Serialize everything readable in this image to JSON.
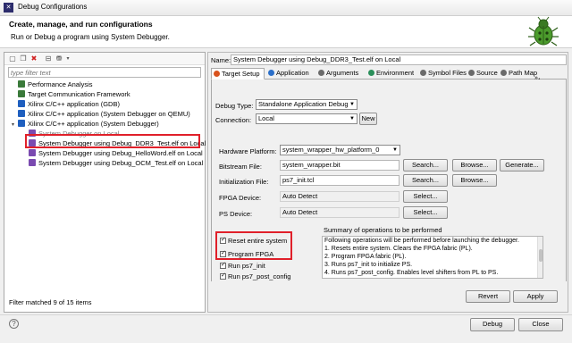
{
  "window": {
    "title": "Debug Configurations"
  },
  "header": {
    "title": "Create, manage, and run configurations",
    "subtitle": "Run or Debug a program using System Debugger."
  },
  "left": {
    "filter_placeholder": "type filter text",
    "items": [
      {
        "label": "Performance Analysis",
        "icon": "performance-icon",
        "color": "#3a7a3a"
      },
      {
        "label": "Target Communication Framework",
        "icon": "tcf-icon",
        "color": "#3a7a3a"
      },
      {
        "label": "Xilinx C/C++ application (GDB)",
        "icon": "c-app-icon",
        "color": "#1f5fbf"
      },
      {
        "label": "Xilinx C/C++ application (System Debugger on QEMU)",
        "icon": "c-app-icon",
        "color": "#1f5fbf"
      },
      {
        "label": "Xilinx C/C++ application (System Debugger)",
        "icon": "c-app-icon",
        "color": "#1f5fbf"
      },
      {
        "label": "System Debugger on Local",
        "icon": "config-icon",
        "color": "#7a4ab0"
      },
      {
        "label": "System Debugger using Debug_DDR3_Test.elf on Local",
        "icon": "config-icon",
        "color": "#7a4ab0"
      },
      {
        "label": "System Debugger using Debug_HelloWord.elf on Local",
        "icon": "config-icon",
        "color": "#7a4ab0"
      },
      {
        "label": "System Debugger using Debug_OCM_Test.elf on Local",
        "icon": "config-icon",
        "color": "#7a4ab0"
      }
    ],
    "filter_status": "Filter matched 9 of 15 items"
  },
  "right": {
    "name_label": "Name:",
    "name_value": "System Debugger using Debug_DDR3_Test.elf on Local",
    "tabs": [
      {
        "label": "Target Setup",
        "color": "#d9531e"
      },
      {
        "label": "Application",
        "color": "#2b6fc9"
      },
      {
        "label": "Arguments",
        "color": "#6a6a6a"
      },
      {
        "label": "Environment",
        "color": "#2a8f5a"
      },
      {
        "label": "Symbol Files",
        "color": "#6a6a6a"
      },
      {
        "label": "Source",
        "color": "#6a6a6a"
      },
      {
        "label": "Path Map",
        "color": "#6a6a6a"
      }
    ],
    "tab_overflow": "»",
    "tab_overflow_count": "1",
    "debug_type_label": "Debug Type:",
    "debug_type_value": "Standalone Application Debug",
    "connection_label": "Connection:",
    "connection_value": "Local",
    "new_button": "New",
    "hw_platform_label": "Hardware Platform:",
    "hw_platform_value": "system_wrapper_hw_platform_0",
    "bitstream_label": "Bitstream File:",
    "bitstream_value": "system_wrapper.bit",
    "init_label": "Initialization File:",
    "init_value": "ps7_init.tcl",
    "fpga_label": "FPGA Device:",
    "fpga_value": "Auto Detect",
    "ps_label": "PS Device:",
    "ps_value": "Auto Detect",
    "search_button": "Search...",
    "browse_button": "Browse...",
    "generate_button": "Generate...",
    "select_button": "Select...",
    "checkboxes": [
      {
        "label": "Reset entire system",
        "checked": true
      },
      {
        "label": "Program FPGA",
        "checked": true
      },
      {
        "label": "Run ps7_init",
        "checked": true
      },
      {
        "label": "Run ps7_post_config",
        "checked": true
      }
    ],
    "summary_title": "Summary of operations to be performed",
    "summary_lines": [
      "Following operations will be performed before launching the debugger.",
      "1. Resets entire system. Clears the FPGA fabric (PL).",
      "2. Program FPGA fabric (PL).",
      "3. Runs ps7_init to initialize PS.",
      "4. Runs ps7_post_config. Enables level shifters from PL to PS."
    ],
    "revert_button": "Revert",
    "apply_button": "Apply"
  },
  "footer": {
    "help": "?",
    "debug_button": "Debug",
    "close_button": "Close"
  },
  "highlight_color": "#e0202a"
}
